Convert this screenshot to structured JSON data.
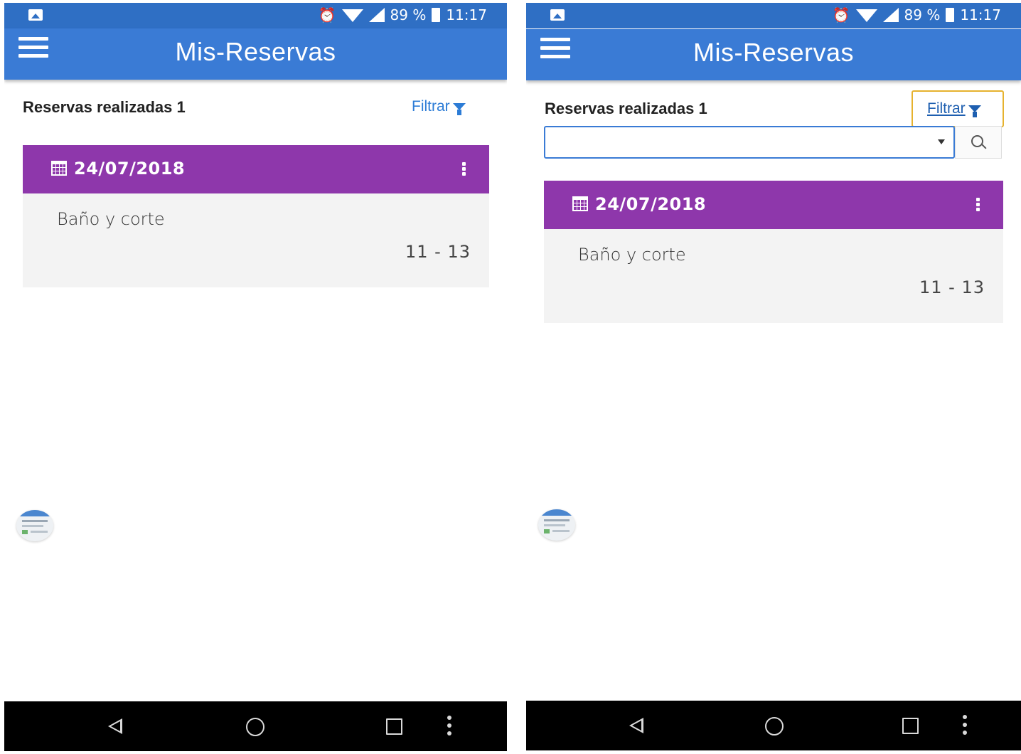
{
  "status": {
    "battery": "89 %",
    "time": "11:17"
  },
  "app": {
    "title": "Mis-Reservas"
  },
  "list": {
    "heading": "Reservas realizadas 1",
    "filter_label": "Filtrar",
    "filter_select_value": ""
  },
  "booking": {
    "date": "24/07/2018",
    "service": "Baño y corte",
    "time_range": "11 - 13"
  },
  "colors": {
    "app_bar": "#3a7bd5",
    "card_header": "#8e37ab",
    "filter_link": "#2c7cd6",
    "focus_border": "#e6b22e"
  },
  "icons": {
    "status": [
      "gallery-icon",
      "alarm-icon",
      "wifi-icon",
      "signal-icon",
      "battery-icon"
    ],
    "appbar": [
      "menu-icon"
    ],
    "filter": [
      "funnel-icon",
      "search-icon",
      "dropdown-arrow-icon"
    ],
    "card": [
      "calendar-icon",
      "kebab-icon"
    ],
    "nav": [
      "back-icon",
      "home-icon",
      "recents-icon",
      "more-icon"
    ]
  }
}
